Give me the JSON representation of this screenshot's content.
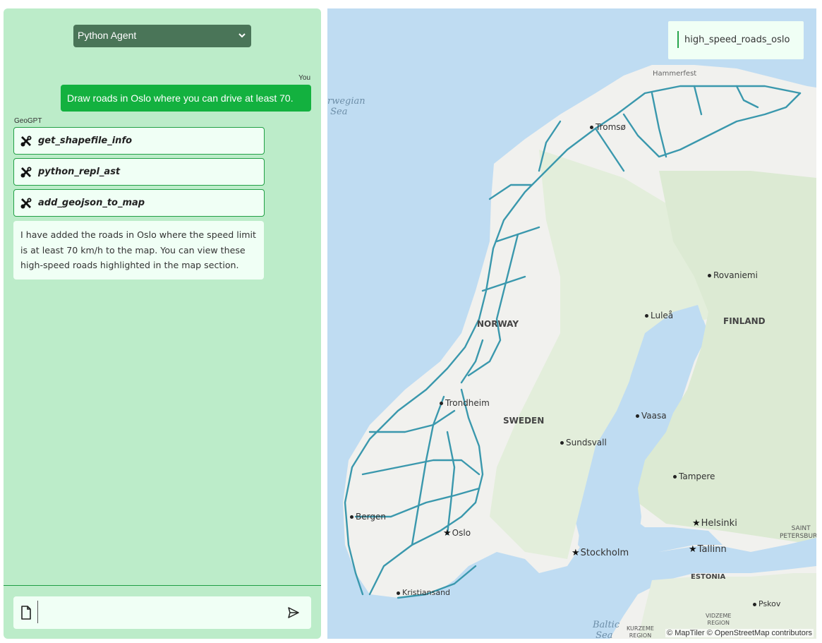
{
  "chat": {
    "agent_select": "Python Agent",
    "you_label": "You",
    "user_message": "Draw roads in Oslo where you can drive at least 70.",
    "bot_label": "GeoGPT",
    "tool_calls": [
      "get_shapefile_info",
      "python_repl_ast",
      "add_geojson_to_map"
    ],
    "bot_message": "I have added the roads in Oslo where the speed limit is at least 70 km/h to the map. You can view these high-speed roads highlighted in the map section.",
    "input_value": ""
  },
  "map": {
    "layer_name": "high_speed_roads_oslo",
    "layer_color": "#3a98ad",
    "attribution": "© MapTiler © OpenStreetMap contributors",
    "labels": {
      "norwegian_sea_1": "rwegian",
      "norwegian_sea_2": "Sea",
      "hammerfest": "Hammerfest",
      "tromso": "Tromsø",
      "rovaniemi": "Rovaniemi",
      "lulea": "Luleå",
      "finland": "FINLAND",
      "norway": "NORWAY",
      "trondheim": "Trondheim",
      "sweden": "SWEDEN",
      "vaasa": "Vaasa",
      "sundsvall": "Sundsvall",
      "tampere": "Tampere",
      "bergen": "Bergen",
      "oslo": "Oslo",
      "helsinki": "Helsinki",
      "stockholm": "Stockholm",
      "tallinn": "Tallinn",
      "saint_petersburg_1": "SAINT",
      "saint_petersburg_2": "PETERSBURG",
      "estonia": "ESTONIA",
      "pskov": "Pskov",
      "kristiansand": "Kristiansand",
      "baltic_1": "Baltic",
      "baltic_2": "Sea",
      "kurzeme_1": "KURZEME",
      "kurzeme_2": "REGION",
      "vidzeme_1": "VIDZEME",
      "vidzeme_2": "REGION"
    }
  }
}
